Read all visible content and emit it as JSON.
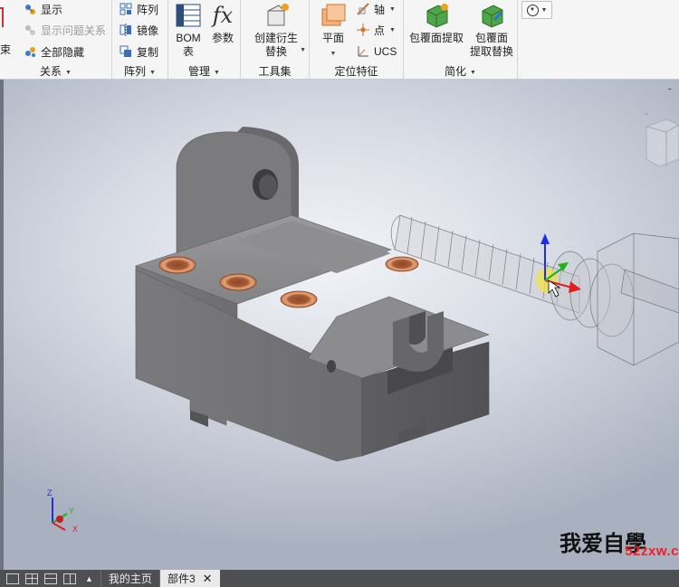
{
  "ribbon": {
    "relations": {
      "label": "关系",
      "constraint_label": "束",
      "show_label": "显示",
      "show_problem_label": "显示问题关系",
      "hide_all_label": "全部隐藏"
    },
    "pattern": {
      "label": "阵列",
      "array_label": "阵列",
      "mirror_label": "镜像",
      "copy_label": "复制"
    },
    "manage": {
      "label": "管理",
      "bom_label_1": "BOM",
      "bom_label_2": "表",
      "params_label": "参数",
      "fx_glyph": "fx"
    },
    "productivity": {
      "label": "工具集",
      "derive_label_1": "创建衍生",
      "derive_label_2": "替换"
    },
    "workfeatures": {
      "label": "定位特征",
      "plane_label": "平面",
      "axis_label": "轴",
      "point_label": "点",
      "ucs_label": "UCS"
    },
    "simplify": {
      "label": "简化",
      "shrinkwrap_label": "包覆面提取",
      "shrinkwrap_sub_label_1": "包覆面",
      "shrinkwrap_sub_label_2": "提取替换"
    }
  },
  "viewport": {
    "minimize_glyph": "-",
    "triad_labels": {
      "z": "Z",
      "y": "Y",
      "x": "X"
    }
  },
  "statusbar": {
    "home_tab": "我的主页",
    "doc_tab": "部件3",
    "close_glyph": "✕",
    "up_glyph": "▲"
  },
  "watermark": {
    "text": "我爱自學",
    "url": "52zxw.c"
  },
  "colors": {
    "ribbon_bg": "#f5f5f5",
    "part_gray": "#7d7d80",
    "bushing_orange": "#c87a4a",
    "triad_x": "#e02020",
    "triad_y": "#20b020",
    "triad_z": "#2030e0",
    "statusbar_bg": "#4d4f53"
  }
}
